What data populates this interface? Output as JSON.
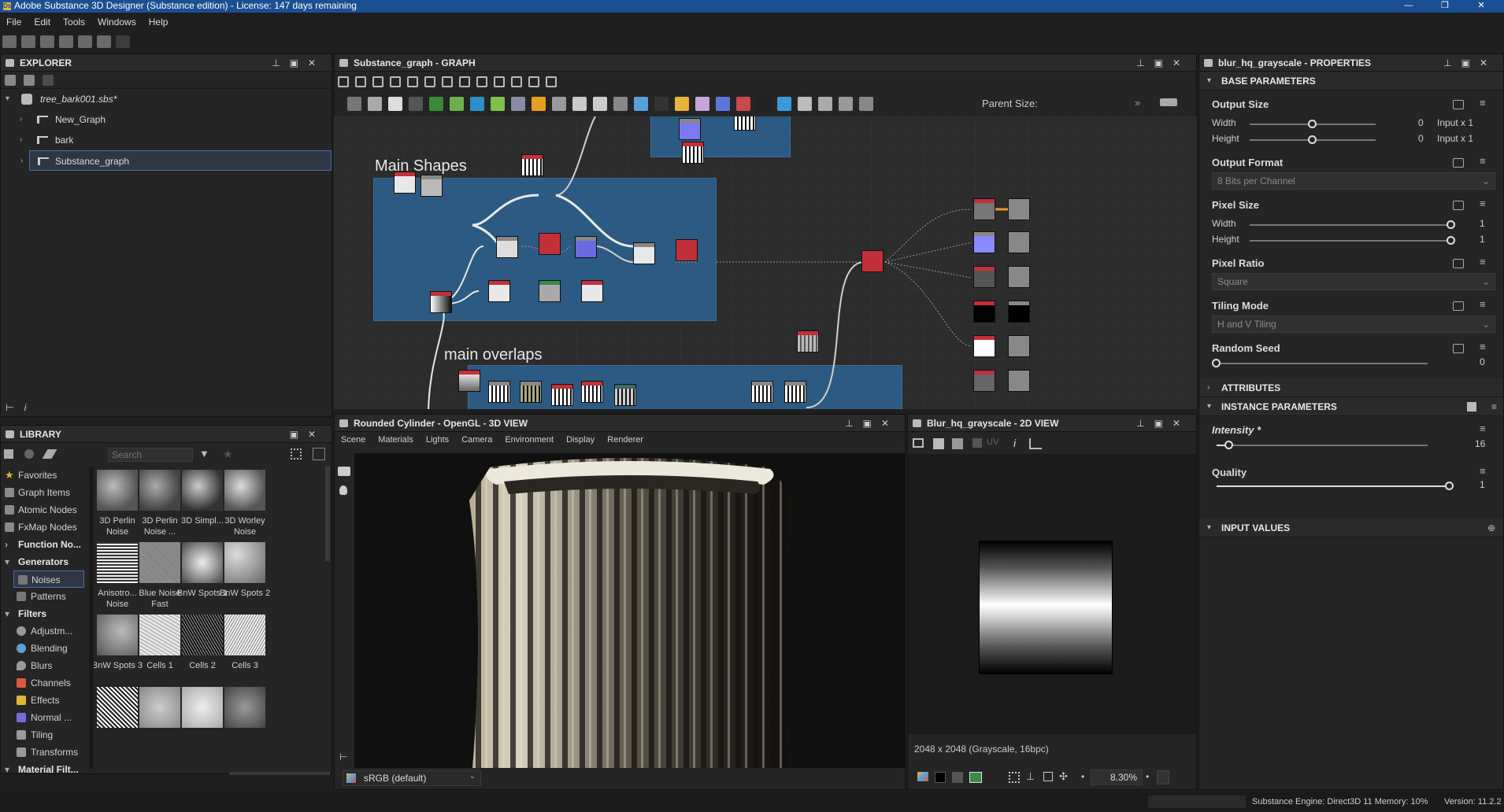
{
  "window": {
    "title": "Adobe Substance 3D Designer (Substance edition) - License: 147 days remaining",
    "controls": [
      "—",
      "❐",
      "✕"
    ]
  },
  "menu": [
    "File",
    "Edit",
    "Tools",
    "Windows",
    "Help"
  ],
  "explorer": {
    "title": "EXPLORER",
    "package": "tree_bark001.sbs*",
    "graphs": [
      "New_Graph",
      "bark",
      "Substance_graph"
    ]
  },
  "library": {
    "title": "LIBRARY",
    "search_placeholder": "Search",
    "categories": [
      {
        "label": "Favorites",
        "icon": "star-icon",
        "color": "#e6b33a"
      },
      {
        "label": "Graph Items",
        "icon": "graph-items-icon",
        "color": "#9a9a9a"
      },
      {
        "label": "Atomic Nodes",
        "icon": "atomic-nodes-icon",
        "color": "#9a9a9a"
      },
      {
        "label": "FxMap Nodes",
        "icon": "fxmap-icon",
        "color": "#9a9a9a"
      },
      {
        "label": "Function No...",
        "icon": "function-icon",
        "color": "#9a9a9a"
      }
    ],
    "generators": "Generators",
    "gen_items": [
      "Noises",
      "Patterns"
    ],
    "filters": "Filters",
    "filter_items": [
      {
        "label": "Adjustm...",
        "color": "#9a9a9a"
      },
      {
        "label": "Blending",
        "color": "#5aa0d8"
      },
      {
        "label": "Blurs",
        "color": "#9a9a9a"
      },
      {
        "label": "Channels",
        "color": "#d9583a"
      },
      {
        "label": "Effects",
        "color": "#e6b33a"
      },
      {
        "label": "Normal ...",
        "color": "#7a6ad8"
      },
      {
        "label": "Tiling",
        "color": "#9a9a9a"
      },
      {
        "label": "Transforms",
        "color": "#9a9a9a"
      }
    ],
    "material_filters": "Material Filt...",
    "thumbs": [
      {
        "label": "3D Perlin Noise"
      },
      {
        "label": "3D Perlin Noise ..."
      },
      {
        "label": "3D Simpl..."
      },
      {
        "label": "3D Worley Noise"
      },
      {
        "label": "Anisotro... Noise"
      },
      {
        "label": "Blue Noise Fast"
      },
      {
        "label": "BnW Spots 1"
      },
      {
        "label": "BnW Spots 2"
      },
      {
        "label": "BnW Spots 3"
      },
      {
        "label": "Cells 1"
      },
      {
        "label": "Cells 2"
      },
      {
        "label": "Cells 3"
      },
      {
        "label": ""
      },
      {
        "label": ""
      },
      {
        "label": ""
      },
      {
        "label": ""
      }
    ]
  },
  "graph": {
    "title": "Substance_graph - GRAPH",
    "parent_size_label": "Parent Size:",
    "frames": [
      "Main Shapes",
      "main overlaps"
    ]
  },
  "view3d": {
    "title": "Rounded Cylinder - OpenGL - 3D VIEW",
    "menu": [
      "Scene",
      "Materials",
      "Lights",
      "Camera",
      "Environment",
      "Display",
      "Renderer"
    ],
    "colorspace": "sRGB (default)"
  },
  "view2d": {
    "title": "Blur_hq_grayscale - 2D VIEW",
    "uv_label": "UV",
    "info": "2048 x 2048 (Grayscale, 16bpc)",
    "zoom": "8.30%"
  },
  "properties": {
    "title": "blur_hq_grayscale - PROPERTIES",
    "base_parameters": "BASE PARAMETERS",
    "output_size": {
      "label": "Output Size",
      "width_label": "Width",
      "width_value": "0",
      "width_suffix": "Input x 1",
      "width_frac": 0.5,
      "height_label": "Height",
      "height_value": "0",
      "height_suffix": "Input x 1",
      "height_frac": 0.5
    },
    "output_format": {
      "label": "Output Format",
      "value": "8 Bits per Channel"
    },
    "pixel_size": {
      "label": "Pixel Size",
      "width_label": "Width",
      "width_value": "1",
      "height_label": "Height",
      "height_value": "1"
    },
    "pixel_ratio": {
      "label": "Pixel Ratio",
      "value": "Square"
    },
    "tiling_mode": {
      "label": "Tiling Mode",
      "value": "H and V Tiling"
    },
    "random_seed": {
      "label": "Random Seed",
      "value": "0"
    },
    "attributes": "ATTRIBUTES",
    "instance_parameters": "INSTANCE PARAMETERS",
    "intensity": {
      "label": "Intensity *",
      "value": "16"
    },
    "quality": {
      "label": "Quality",
      "value": "1"
    },
    "input_values": "INPUT VALUES"
  },
  "status": {
    "engine": "Substance Engine: Direct3D 11  Memory: 10%",
    "version": "Version: 11.2.2"
  }
}
